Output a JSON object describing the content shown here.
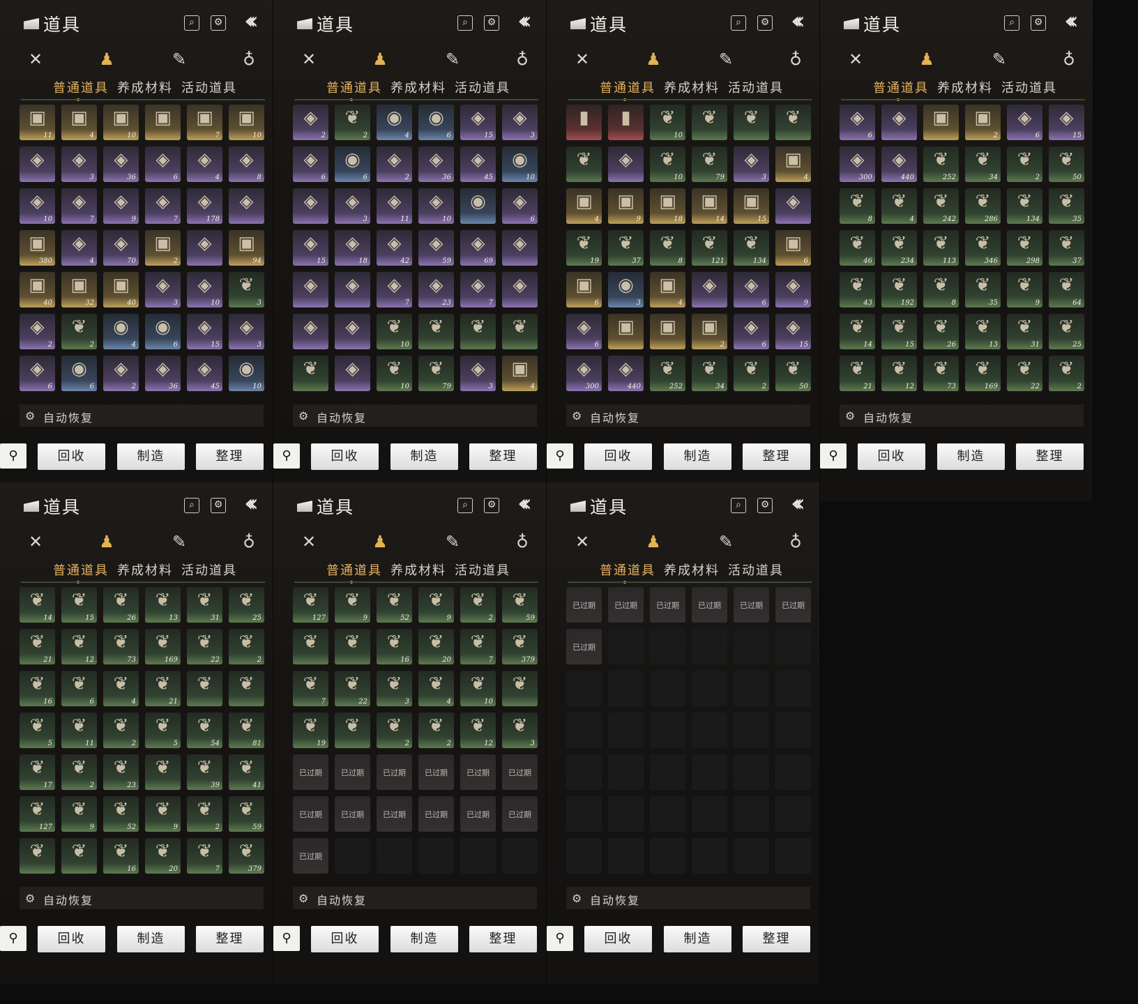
{
  "title": "道具",
  "search_icon": "search-icon",
  "settings_icon": "gear-icon",
  "back_icon": "double-chevron-left-icon",
  "categories": [
    "crossed-swords-icon",
    "pouch-icon",
    "scroll-icon",
    "gourd-icon"
  ],
  "subtabs": [
    "普通道具",
    "养成材料",
    "活动道具"
  ],
  "auto_restore_label": "自动恢复",
  "buttons": {
    "recycle": "回收",
    "craft": "制造",
    "sort": "整理"
  },
  "expired_label": "已过期",
  "colors": {
    "accent": "#e6b25e",
    "background": "#0d0c0c"
  },
  "panels": [
    {
      "items": [
        [
          "gold",
          "11"
        ],
        [
          "gold",
          "4"
        ],
        [
          "gold",
          "10"
        ],
        [
          "gold",
          ""
        ],
        [
          "gold",
          "7"
        ],
        [
          "gold",
          "10"
        ],
        [
          "purple",
          ""
        ],
        [
          "purple",
          "3"
        ],
        [
          "purple",
          "36"
        ],
        [
          "purple",
          "6"
        ],
        [
          "purple",
          "4"
        ],
        [
          "purple",
          "8"
        ],
        [
          "purple",
          "10"
        ],
        [
          "purple",
          "7"
        ],
        [
          "purple",
          "9"
        ],
        [
          "purple",
          "7"
        ],
        [
          "purple",
          "178"
        ],
        [
          "purple",
          ""
        ],
        [
          "gold",
          "380"
        ],
        [
          "purple",
          "4"
        ],
        [
          "purple",
          "70"
        ],
        [
          "gold",
          "2"
        ],
        [
          "purple",
          ""
        ],
        [
          "gold",
          "94"
        ],
        [
          "gold",
          "40"
        ],
        [
          "gold",
          "32"
        ],
        [
          "gold",
          "40"
        ],
        [
          "purple",
          "3"
        ],
        [
          "purple",
          "10"
        ],
        [
          "green",
          "3"
        ],
        [
          "purple",
          "2"
        ],
        [
          "green",
          "2"
        ],
        [
          "blue",
          "4"
        ],
        [
          "blue",
          "6"
        ],
        [
          "purple",
          "15"
        ],
        [
          "purple",
          "3"
        ],
        [
          "purple",
          "6"
        ],
        [
          "blue",
          "6"
        ],
        [
          "purple",
          "2"
        ],
        [
          "purple",
          "36"
        ],
        [
          "purple",
          "45"
        ],
        [
          "blue",
          "10"
        ]
      ]
    },
    {
      "items": [
        [
          "purple",
          "2"
        ],
        [
          "green",
          "2"
        ],
        [
          "blue",
          "4"
        ],
        [
          "blue",
          "6"
        ],
        [
          "purple",
          "15"
        ],
        [
          "purple",
          "3"
        ],
        [
          "purple",
          "6"
        ],
        [
          "blue",
          "6"
        ],
        [
          "purple",
          "2"
        ],
        [
          "purple",
          "36"
        ],
        [
          "purple",
          "45"
        ],
        [
          "blue",
          "10"
        ],
        [
          "purple",
          ""
        ],
        [
          "purple",
          "3"
        ],
        [
          "purple",
          "11"
        ],
        [
          "purple",
          "10"
        ],
        [
          "blue",
          ""
        ],
        [
          "purple",
          "6"
        ],
        [
          "purple",
          "15"
        ],
        [
          "purple",
          "18"
        ],
        [
          "purple",
          "42"
        ],
        [
          "purple",
          "59"
        ],
        [
          "purple",
          "69"
        ],
        [
          "purple",
          ""
        ],
        [
          "purple",
          ""
        ],
        [
          "purple",
          ""
        ],
        [
          "purple",
          "7"
        ],
        [
          "purple",
          "23"
        ],
        [
          "purple",
          "7"
        ],
        [
          "purple",
          ""
        ],
        [
          "purple",
          ""
        ],
        [
          "purple",
          ""
        ],
        [
          "green",
          "10"
        ],
        [
          "green",
          ""
        ],
        [
          "green",
          ""
        ],
        [
          "green",
          ""
        ],
        [
          "green",
          ""
        ],
        [
          "purple",
          ""
        ],
        [
          "green",
          "10"
        ],
        [
          "green",
          "79"
        ],
        [
          "purple",
          "3"
        ],
        [
          "gold",
          "4"
        ]
      ]
    },
    {
      "items": [
        [
          "red",
          ""
        ],
        [
          "red",
          ""
        ],
        [
          "green",
          "10"
        ],
        [
          "green",
          ""
        ],
        [
          "green",
          ""
        ],
        [
          "green",
          ""
        ],
        [
          "green",
          ""
        ],
        [
          "purple",
          ""
        ],
        [
          "green",
          "10"
        ],
        [
          "green",
          "79"
        ],
        [
          "purple",
          "3"
        ],
        [
          "gold",
          "4"
        ],
        [
          "gold",
          "4"
        ],
        [
          "gold",
          "9"
        ],
        [
          "gold",
          "18"
        ],
        [
          "gold",
          "14"
        ],
        [
          "gold",
          "15"
        ],
        [
          "purple",
          ""
        ],
        [
          "green",
          "19"
        ],
        [
          "green",
          "37"
        ],
        [
          "green",
          "8"
        ],
        [
          "green",
          "121"
        ],
        [
          "green",
          "134"
        ],
        [
          "gold",
          "6"
        ],
        [
          "gold",
          "6"
        ],
        [
          "blue",
          "3"
        ],
        [
          "gold",
          "4"
        ],
        [
          "purple",
          ""
        ],
        [
          "purple",
          "6"
        ],
        [
          "purple",
          "9"
        ],
        [
          "purple",
          "6"
        ],
        [
          "gold",
          ""
        ],
        [
          "gold",
          ""
        ],
        [
          "gold",
          "2"
        ],
        [
          "purple",
          "6"
        ],
        [
          "purple",
          "15"
        ],
        [
          "purple",
          "300"
        ],
        [
          "purple",
          "440"
        ],
        [
          "green",
          "252"
        ],
        [
          "green",
          "34"
        ],
        [
          "green",
          "2"
        ],
        [
          "green",
          "50"
        ]
      ]
    },
    {
      "items": [
        [
          "purple",
          "6"
        ],
        [
          "purple",
          ""
        ],
        [
          "gold",
          ""
        ],
        [
          "gold",
          "2"
        ],
        [
          "purple",
          "6"
        ],
        [
          "purple",
          "15"
        ],
        [
          "purple",
          "300"
        ],
        [
          "purple",
          "440"
        ],
        [
          "green",
          "252"
        ],
        [
          "green",
          "34"
        ],
        [
          "green",
          "2"
        ],
        [
          "green",
          "50"
        ],
        [
          "green",
          "8"
        ],
        [
          "green",
          "4"
        ],
        [
          "green",
          "242"
        ],
        [
          "green",
          "286"
        ],
        [
          "green",
          "134"
        ],
        [
          "green",
          "35"
        ],
        [
          "green",
          "46"
        ],
        [
          "green",
          "234"
        ],
        [
          "green",
          "113"
        ],
        [
          "green",
          "346"
        ],
        [
          "green",
          "298"
        ],
        [
          "green",
          "37"
        ],
        [
          "green",
          "43"
        ],
        [
          "green",
          "192"
        ],
        [
          "green",
          "8"
        ],
        [
          "green",
          "35"
        ],
        [
          "green",
          "9"
        ],
        [
          "green",
          "64"
        ],
        [
          "green",
          "14"
        ],
        [
          "green",
          "15"
        ],
        [
          "green",
          "26"
        ],
        [
          "green",
          "13"
        ],
        [
          "green",
          "31"
        ],
        [
          "green",
          "25"
        ],
        [
          "green",
          "21"
        ],
        [
          "green",
          "12"
        ],
        [
          "green",
          "73"
        ],
        [
          "green",
          "169"
        ],
        [
          "green",
          "22"
        ],
        [
          "green",
          "2"
        ]
      ]
    },
    {
      "items": [
        [
          "green",
          "14"
        ],
        [
          "green",
          "15"
        ],
        [
          "green",
          "26"
        ],
        [
          "green",
          "13"
        ],
        [
          "green",
          "31"
        ],
        [
          "green",
          "25"
        ],
        [
          "green",
          "21"
        ],
        [
          "green",
          "12"
        ],
        [
          "green",
          "73"
        ],
        [
          "green",
          "169"
        ],
        [
          "green",
          "22"
        ],
        [
          "green",
          "2"
        ],
        [
          "green",
          "16"
        ],
        [
          "green",
          "6"
        ],
        [
          "green",
          "4"
        ],
        [
          "green",
          "21"
        ],
        [
          "green",
          ""
        ],
        [
          "green",
          ""
        ],
        [
          "green",
          "5"
        ],
        [
          "green",
          "11"
        ],
        [
          "green",
          "2"
        ],
        [
          "green",
          "5"
        ],
        [
          "green",
          "54"
        ],
        [
          "green",
          "81"
        ],
        [
          "green",
          "17"
        ],
        [
          "green",
          "2"
        ],
        [
          "green",
          "23"
        ],
        [
          "green",
          ""
        ],
        [
          "green",
          "39"
        ],
        [
          "green",
          "41"
        ],
        [
          "green",
          "127"
        ],
        [
          "green",
          "9"
        ],
        [
          "green",
          "52"
        ],
        [
          "green",
          "9"
        ],
        [
          "green",
          "2"
        ],
        [
          "green",
          "59"
        ],
        [
          "green",
          ""
        ],
        [
          "green",
          ""
        ],
        [
          "green",
          "16"
        ],
        [
          "green",
          "20"
        ],
        [
          "green",
          "7"
        ],
        [
          "green",
          "379"
        ]
      ]
    },
    {
      "items": [
        [
          "green",
          "127"
        ],
        [
          "green",
          "9"
        ],
        [
          "green",
          "52"
        ],
        [
          "green",
          "9"
        ],
        [
          "green",
          "2"
        ],
        [
          "green",
          "59"
        ],
        [
          "green",
          ""
        ],
        [
          "green",
          ""
        ],
        [
          "green",
          "16"
        ],
        [
          "green",
          "20"
        ],
        [
          "green",
          "7"
        ],
        [
          "green",
          "379"
        ],
        [
          "green",
          "7"
        ],
        [
          "green",
          "22"
        ],
        [
          "green",
          "3"
        ],
        [
          "green",
          "4"
        ],
        [
          "green",
          "10"
        ],
        [
          "green",
          ""
        ],
        [
          "green",
          "19"
        ],
        [
          "green",
          ""
        ],
        [
          "green",
          "2"
        ],
        [
          "green",
          "2"
        ],
        [
          "green",
          "12"
        ],
        [
          "green",
          "3"
        ],
        [
          "expired",
          ""
        ],
        [
          "expired",
          ""
        ],
        [
          "expired",
          ""
        ],
        [
          "expired",
          ""
        ],
        [
          "expired",
          ""
        ],
        [
          "expired",
          ""
        ],
        [
          "expired",
          ""
        ],
        [
          "expired",
          ""
        ],
        [
          "expired",
          ""
        ],
        [
          "expired",
          ""
        ],
        [
          "expired",
          ""
        ],
        [
          "expired",
          ""
        ],
        [
          "expired",
          ""
        ],
        [
          "empty",
          ""
        ],
        [
          "empty",
          ""
        ],
        [
          "empty",
          ""
        ],
        [
          "empty",
          ""
        ],
        [
          "empty",
          ""
        ]
      ]
    },
    {
      "items": [
        [
          "expired",
          ""
        ],
        [
          "expired",
          ""
        ],
        [
          "expired",
          ""
        ],
        [
          "expired",
          ""
        ],
        [
          "expired",
          ""
        ],
        [
          "expired",
          ""
        ],
        [
          "expired",
          ""
        ],
        [
          "empty",
          ""
        ],
        [
          "empty",
          ""
        ],
        [
          "empty",
          ""
        ],
        [
          "empty",
          ""
        ],
        [
          "empty",
          ""
        ],
        [
          "empty",
          ""
        ],
        [
          "empty",
          ""
        ],
        [
          "empty",
          ""
        ],
        [
          "empty",
          ""
        ],
        [
          "empty",
          ""
        ],
        [
          "empty",
          ""
        ],
        [
          "empty",
          ""
        ],
        [
          "empty",
          ""
        ],
        [
          "empty",
          ""
        ],
        [
          "empty",
          ""
        ],
        [
          "empty",
          ""
        ],
        [
          "empty",
          ""
        ],
        [
          "empty",
          ""
        ],
        [
          "empty",
          ""
        ],
        [
          "empty",
          ""
        ],
        [
          "empty",
          ""
        ],
        [
          "empty",
          ""
        ],
        [
          "empty",
          ""
        ],
        [
          "empty",
          ""
        ],
        [
          "empty",
          ""
        ],
        [
          "empty",
          ""
        ],
        [
          "empty",
          ""
        ],
        [
          "empty",
          ""
        ],
        [
          "empty",
          ""
        ],
        [
          "empty",
          ""
        ],
        [
          "empty",
          ""
        ],
        [
          "empty",
          ""
        ],
        [
          "empty",
          ""
        ],
        [
          "empty",
          ""
        ],
        [
          "empty",
          ""
        ]
      ]
    }
  ]
}
